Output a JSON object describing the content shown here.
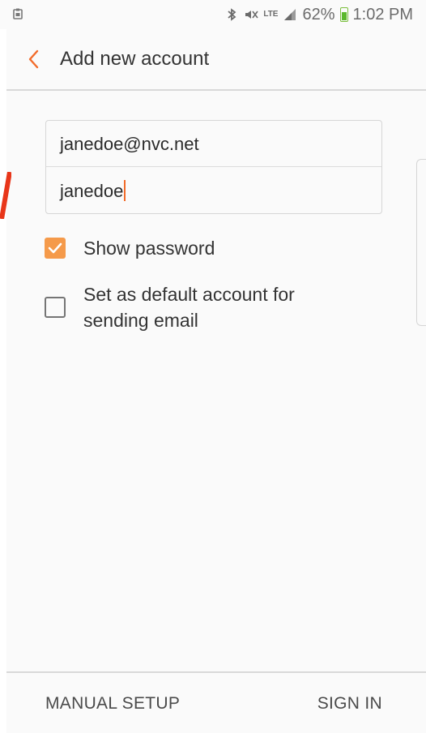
{
  "status_bar": {
    "left_icon": "clipboard-icon",
    "network": "LTE",
    "battery": "62%",
    "time": "1:02 PM",
    "icons": [
      "bluetooth-icon",
      "mute-icon",
      "signal-icon",
      "battery-icon"
    ]
  },
  "header": {
    "back_icon": "chevron-left-icon",
    "title": "Add new account"
  },
  "form": {
    "email_value": "janedoe@nvc.net",
    "password_value": "janedoe"
  },
  "options": {
    "show_password_label": "Show password",
    "show_password_checked": true,
    "default_account_label_line1": "Set as default account for",
    "default_account_label_line2": "sending email",
    "default_account_checked": false
  },
  "footer": {
    "manual_setup": "MANUAL SETUP",
    "sign_in": "SIGN IN"
  },
  "colors": {
    "accent": "#f26b2a",
    "checkbox_checked": "#f59a4a",
    "battery_green": "#5bb82c"
  }
}
